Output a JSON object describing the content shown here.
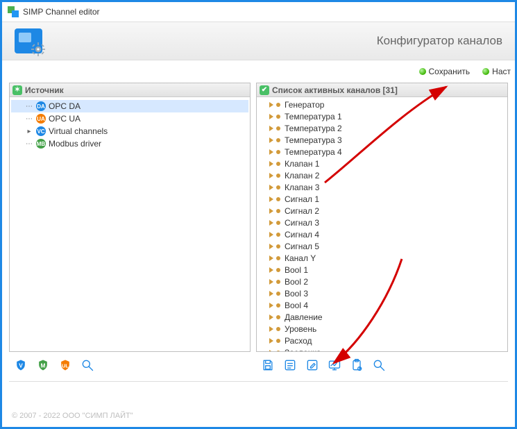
{
  "window": {
    "title": "SIMP Channel editor"
  },
  "banner": {
    "title": "Конфигуратор каналов"
  },
  "top_toolbar": {
    "save": "Сохранить",
    "settings": "Наст"
  },
  "source_panel": {
    "title": "Источник",
    "items": [
      {
        "label": "OPC DA",
        "icon": "da",
        "selected": true,
        "expandable": false
      },
      {
        "label": "OPC UA",
        "icon": "ua",
        "selected": false,
        "expandable": false
      },
      {
        "label": "Virtual channels",
        "icon": "vc",
        "selected": false,
        "expandable": true
      },
      {
        "label": "Modbus driver",
        "icon": "mb",
        "selected": false,
        "expandable": false
      }
    ]
  },
  "active_panel": {
    "title": "Список активных каналов [31]",
    "items": [
      "Генератор",
      "Температура 1",
      "Температура 2",
      "Температура 3",
      "Температура 4",
      "Клапан 1",
      "Клапан 2",
      "Клапан 3",
      "Сигнал 1",
      "Сигнал 2",
      "Сигнал 3",
      "Сигнал 4",
      "Сигнал 5",
      "Канал Y",
      "Bool 1",
      "Bool 2",
      "Bool 3",
      "Bool 4",
      "Давление",
      "Уровень",
      "Расход",
      "Заслонка"
    ]
  },
  "left_buttons": [
    "shield-v-icon",
    "shield-m-icon",
    "shield-ul-icon",
    "search-icon"
  ],
  "right_buttons": [
    "save-disk-icon",
    "props-icon",
    "edit-icon",
    "chart-icon",
    "clipboard-icon",
    "search-icon"
  ],
  "footer": "© 2007 - 2022  ООО \"СИМП ЛАЙТ\""
}
